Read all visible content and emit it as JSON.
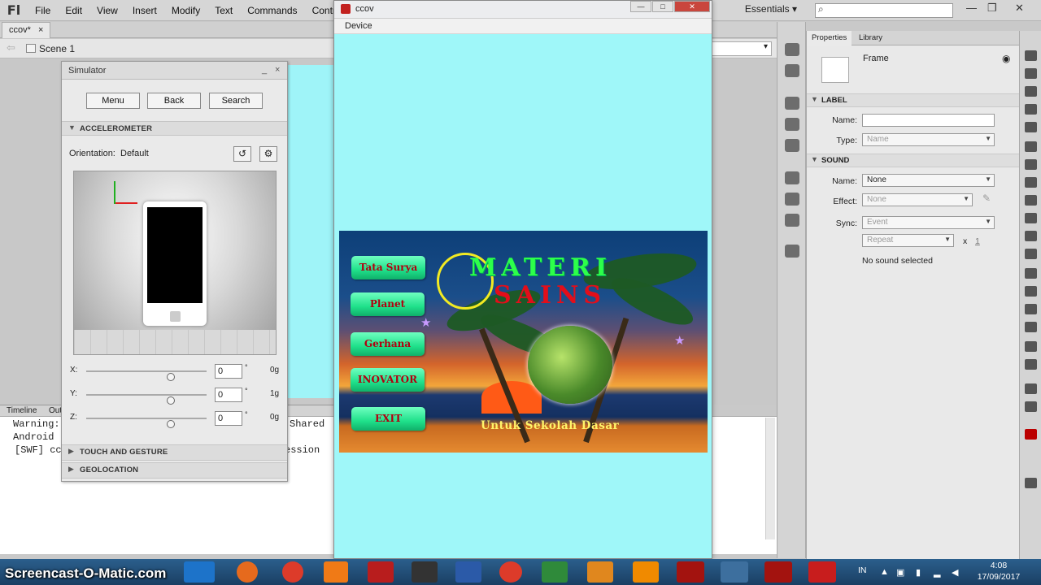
{
  "app": {
    "logo": "Fl",
    "menu": [
      "File",
      "Edit",
      "View",
      "Insert",
      "Modify",
      "Text",
      "Commands",
      "Control"
    ],
    "workspace": "Essentials",
    "workspace_caret": "▾",
    "search_icon": "search-icon"
  },
  "document": {
    "tab": "ccov*",
    "tab_close": "×",
    "scene": "Scene 1"
  },
  "output": {
    "tabs": [
      "Timeline",
      "Out"
    ],
    "lines": [
      "Warning:",
      "Android",
      "[SWF] cc"
    ],
    "right_fragments": [
      "Shared",
      "ession"
    ]
  },
  "simulator": {
    "title": "Simulator",
    "minimize": "_",
    "close": "×",
    "buttons": [
      "Menu",
      "Back",
      "Search"
    ],
    "accelerometer": "ACCELEROMETER",
    "orientation_label": "Orientation:",
    "orientation_value": "Default",
    "sliders": [
      {
        "label": "X:",
        "value": "0",
        "unit": "°",
        "g": "0g"
      },
      {
        "label": "Y:",
        "value": "0",
        "unit": "°",
        "g": "1g"
      },
      {
        "label": "Z:",
        "value": "0",
        "unit": "°",
        "g": "0g"
      }
    ],
    "touch": "TOUCH AND GESTURE",
    "geolocation": "GEOLOCATION"
  },
  "device": {
    "title": "ccov",
    "menu": "Device",
    "controls": [
      "—",
      "□",
      "✕"
    ]
  },
  "app_screen": {
    "buttons": [
      "Tata Surya",
      "Planet",
      "Gerhana",
      "INOVATOR",
      "EXIT"
    ],
    "title_line1": "MATERI",
    "title_line2": "SAINS",
    "subtitle": "Untuk Sekolah Dasar",
    "colors": {
      "title1": "#2dff4a",
      "title2": "#e30e1a",
      "subtitle": "#fff46a",
      "button": "#1fe08a",
      "background": "#9ff7f9"
    }
  },
  "properties": {
    "tabs": [
      "Properties",
      "Library"
    ],
    "frame_label": "Frame",
    "label_section": "LABEL",
    "name_label": "Name:",
    "name_value": "",
    "type_label": "Type:",
    "type_value": "Name",
    "sound_section": "SOUND",
    "sound_name_label": "Name:",
    "sound_name_value": "None",
    "effect_label": "Effect:",
    "effect_value": "None",
    "sync_label": "Sync:",
    "sync_value": "Event",
    "repeat_value": "Repeat",
    "repeat_x": "x",
    "repeat_count": "1",
    "no_sound": "No sound selected"
  },
  "taskbar": {
    "watermark": "Screencast-O-Matic.com",
    "lang": "IN",
    "time": "4:08",
    "date": "17/09/2017"
  }
}
